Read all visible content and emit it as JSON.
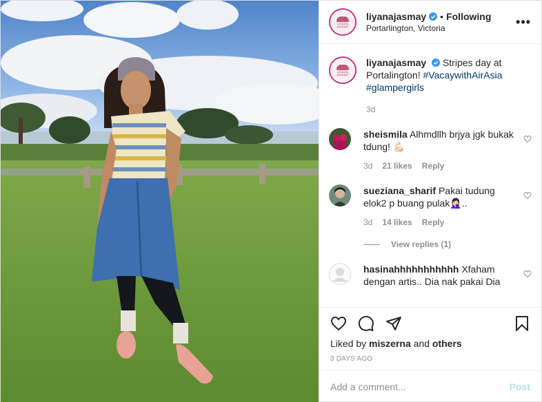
{
  "header": {
    "username": "liyanajasmay",
    "separator": "•",
    "follow_label": "Following",
    "location": "Portarlington, Victoria",
    "more_icon": "more-options-icon"
  },
  "avatar_logo_text": "LIYANA JASMAY",
  "caption": {
    "username": "liyanajasmay",
    "text_before": "Stripes day at Portalington! ",
    "hashtag1": "#VacaywithAirAsia",
    "hashtag2": "#glampergirls",
    "time": "3d"
  },
  "comments": [
    {
      "username": "sheismila",
      "text": "Alhmdllh brjya jgk bukak tdung! 💪🏻",
      "time": "3d",
      "likes": "21 likes",
      "reply": "Reply"
    },
    {
      "username": "sueziana_sharif",
      "text": "Pakai tudung elok2 p buang pulak🤦🏻‍♀️..",
      "time": "3d",
      "likes": "14 likes",
      "reply": "Reply"
    },
    {
      "username": "hasinahhhhhhhhhhh",
      "text": "Xfaham dengan artis.. Dia nak pakai Dia"
    }
  ],
  "view_replies": "View replies (1)",
  "likes_line": {
    "prefix": "Liked by",
    "user": "miszerna",
    "joiner": "and",
    "others": "others"
  },
  "post_time": "3 DAYS AGO",
  "comment_input": {
    "placeholder": "Add a comment...",
    "post_label": "Post"
  },
  "colors": {
    "link": "#00376b",
    "verified": "#3897f0",
    "post_disabled": "#b2dffc",
    "muted": "#8e8e8e"
  }
}
